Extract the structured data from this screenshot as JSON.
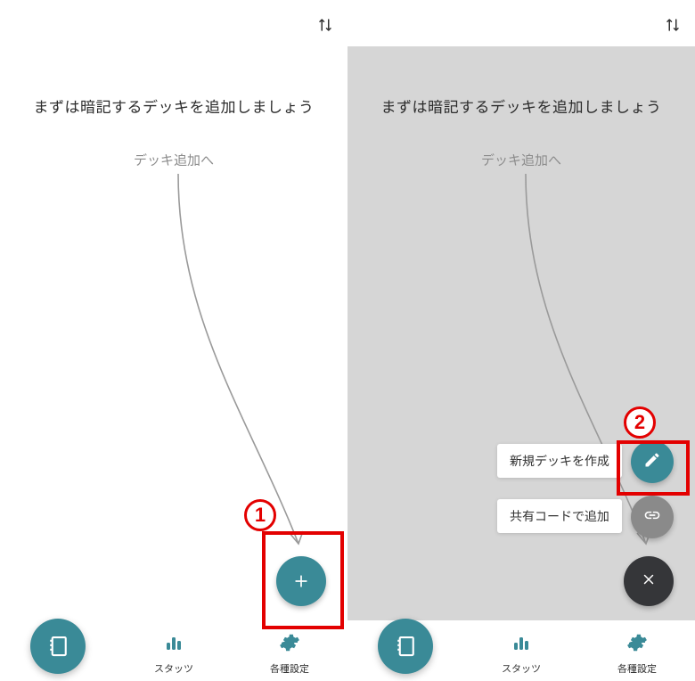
{
  "colors": {
    "accent": "#3a8a97",
    "dim": "#d6d6d6",
    "fab_dark": "#353639",
    "annotation": "#e30000"
  },
  "screen_left": {
    "topbar": {
      "sort_label": "sort"
    },
    "empty": {
      "title": "まずは暗記するデッキを追加しましょう",
      "subtitle": "デッキ追加へ"
    },
    "fab_main": {
      "label": "+"
    },
    "nav": {
      "decks_label": "",
      "stats_label": "スタッツ",
      "settings_label": "各種設定"
    },
    "annotation": {
      "number": "1"
    }
  },
  "screen_right": {
    "topbar": {
      "sort_label": "sort"
    },
    "empty": {
      "title": "まずは暗記するデッキを追加しましょう",
      "subtitle": "デッキ追加へ"
    },
    "fab_options": [
      {
        "label": "新規デッキを作成",
        "icon": "pencil"
      },
      {
        "label": "共有コードで追加",
        "icon": "link"
      }
    ],
    "fab_close": {
      "label": "×"
    },
    "nav": {
      "decks_label": "",
      "stats_label": "スタッツ",
      "settings_label": "各種設定"
    },
    "annotation": {
      "number": "2"
    }
  }
}
